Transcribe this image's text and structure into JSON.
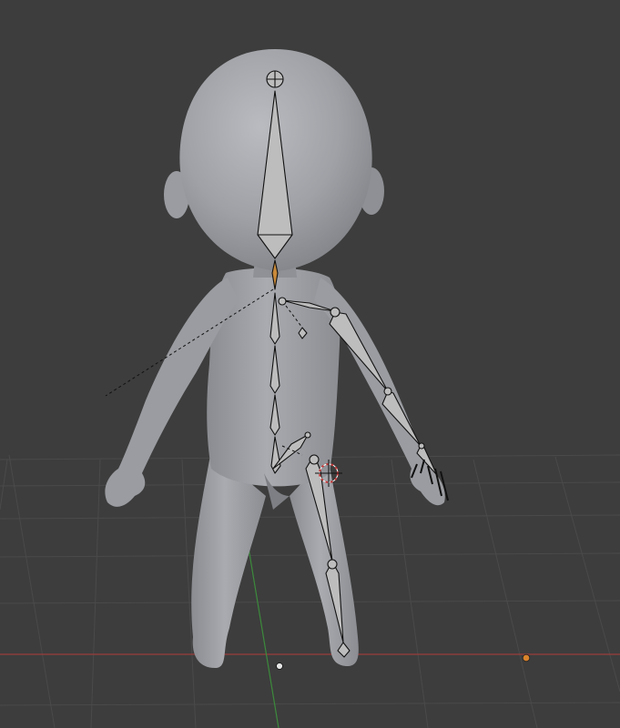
{
  "app": "3D Viewport",
  "viewport": {
    "background_color": "#3d3d3d",
    "grid_color": "#494949",
    "x_axis_color": "#9a3c3c",
    "y_axis_color": "#3c8a3c",
    "mesh_color": "#9c9ea3",
    "bone_color": "#bdbdbd",
    "bone_outline_color": "#111111",
    "cursor_color": "#c03a3a",
    "light_color": "#d9822b"
  },
  "scene": {
    "objects": [
      "character-mesh",
      "armature",
      "3d-cursor",
      "light-origin"
    ]
  }
}
